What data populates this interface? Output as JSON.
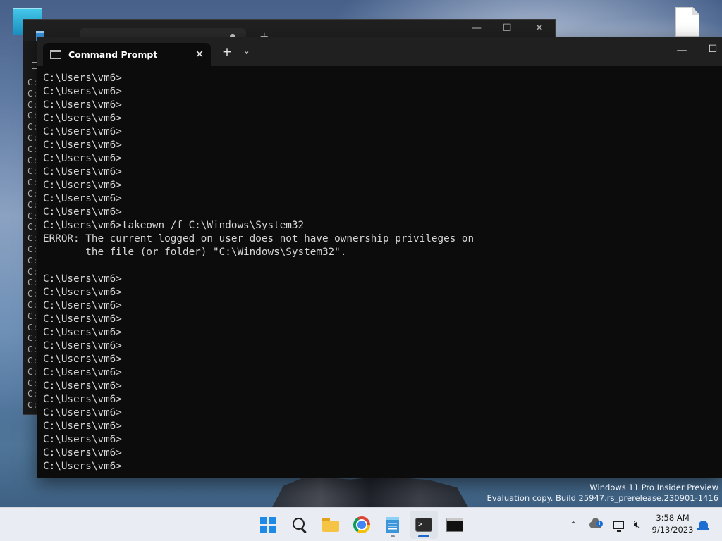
{
  "terminal": {
    "tab_title": "Command Prompt",
    "tab_close": "✕",
    "new_tab": "+",
    "tab_dropdown": "⌄",
    "window_minimize": "—",
    "window_maximize": "☐",
    "lines": [
      "C:\\Users\\vm6>",
      "C:\\Users\\vm6>",
      "C:\\Users\\vm6>",
      "C:\\Users\\vm6>",
      "C:\\Users\\vm6>",
      "C:\\Users\\vm6>",
      "C:\\Users\\vm6>",
      "C:\\Users\\vm6>",
      "C:\\Users\\vm6>",
      "C:\\Users\\vm6>",
      "C:\\Users\\vm6>",
      "C:\\Users\\vm6>takeown /f C:\\Windows\\System32",
      "ERROR: The current logged on user does not have ownership privileges on",
      "       the file (or folder) \"C:\\Windows\\System32\".",
      "",
      "C:\\Users\\vm6>",
      "C:\\Users\\vm6>",
      "C:\\Users\\vm6>",
      "C:\\Users\\vm6>",
      "C:\\Users\\vm6>",
      "C:\\Users\\vm6>",
      "C:\\Users\\vm6>",
      "C:\\Users\\vm6>",
      "C:\\Users\\vm6>",
      "C:\\Users\\vm6>",
      "C:\\Users\\vm6>",
      "C:\\Users\\vm6>",
      "C:\\Users\\vm6>",
      "C:\\Users\\vm6>",
      "C:\\Users\\vm6>"
    ]
  },
  "background_window": {
    "new_tab": "+",
    "minimize": "—",
    "maximize": "☐",
    "close": "✕",
    "edge_text": "C:\nC:\nC:\nC:\nC:\nC:\nC:\nC:\nC:\nC:\nC:\nC:\nC:\nC:\nC:\nC:\nC:\nC:\nC:\nC:\nC:\nC:\nC:\nC:\nC:\nC:\nC:\nC:\nC:\nC:"
  },
  "watermark": {
    "line1": "Windows 11 Pro Insider Preview",
    "line2": "Evaluation copy. Build 25947.rs_prerelease.230901-1416"
  },
  "taskbar": {
    "apps": [
      {
        "name": "start",
        "icon": "windows-logo"
      },
      {
        "name": "search",
        "icon": "search-icon"
      },
      {
        "name": "file-explorer",
        "icon": "folder-icon"
      },
      {
        "name": "chrome",
        "icon": "chrome-icon"
      },
      {
        "name": "notepad",
        "icon": "notepad-icon"
      },
      {
        "name": "terminal",
        "icon": "terminal-icon"
      },
      {
        "name": "command-prompt",
        "icon": "cmd-icon"
      }
    ],
    "tray_chevron": "⌃",
    "volume_glyph": "🔇︎",
    "clock_time": "3:58 AM",
    "clock_date": "9/13/2023"
  },
  "colors": {
    "terminal_bg": "#0c0c0c",
    "terminal_fg": "#d6d6d6",
    "taskbar_bg": "#e9ecf2",
    "accent": "#1e66c9"
  }
}
